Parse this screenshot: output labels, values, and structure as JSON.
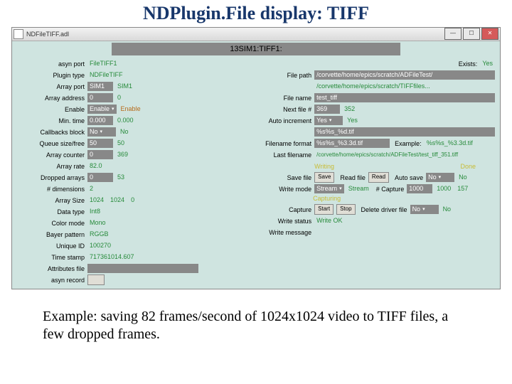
{
  "title": "NDPlugin.File display: TIFF",
  "window": {
    "title": "NDFileTIFF.adl"
  },
  "header": "13SIM1:TIFF1:",
  "left": {
    "asyn_port": {
      "label": "asyn port",
      "value": "FileTIFF1"
    },
    "plugin_type": {
      "label": "Plugin type",
      "value": "NDFileTIFF"
    },
    "array_port": {
      "label": "Array port",
      "field": "SIM1",
      "ro": "SIM1"
    },
    "array_addr": {
      "label": "Array address",
      "field": "0",
      "ro": "0"
    },
    "enable": {
      "label": "Enable",
      "field": "Enable",
      "ro": "Enable"
    },
    "min_time": {
      "label": "Min. time",
      "field": "0.000",
      "ro": "0.000"
    },
    "callbacks": {
      "label": "Callbacks block",
      "field": "No",
      "ro": "No"
    },
    "queue": {
      "label": "Queue size/free",
      "field": "50",
      "ro": "50"
    },
    "counter": {
      "label": "Array counter",
      "field": "0",
      "ro": "369"
    },
    "rate": {
      "label": "Array rate",
      "ro": "82.0"
    },
    "dropped": {
      "label": "Dropped arrays",
      "field": "0",
      "ro": "53"
    },
    "dims": {
      "label": "# dimensions",
      "ro": "2"
    },
    "size": {
      "label": "Array Size",
      "a": "1024",
      "b": "1024",
      "c": "0"
    },
    "dtype": {
      "label": "Data type",
      "ro": "Int8"
    },
    "cmode": {
      "label": "Color mode",
      "ro": "Mono"
    },
    "bayer": {
      "label": "Bayer pattern",
      "ro": "RGGB"
    },
    "uid": {
      "label": "Unique ID",
      "ro": "100270"
    },
    "ts": {
      "label": "Time stamp",
      "ro": "717361014.607"
    },
    "attr": {
      "label": "Attributes file",
      "field": ""
    },
    "arec": {
      "label": "asyn record",
      "btn": " "
    }
  },
  "right": {
    "filepath": {
      "label": "File path",
      "field": "/corvette/home/epics/scratch/ADFileTest/",
      "exists_lab": "Exists:",
      "exists": "Yes"
    },
    "filepath2": {
      "field": "/corvette/home/epics/scratch/TIFFfiles...",
      "label": ""
    },
    "fname": {
      "label": "File name",
      "field": "test_tiff"
    },
    "nextn": {
      "label": "Next file #",
      "field": "369",
      "ro": "352"
    },
    "autoinc": {
      "label": "Auto increment",
      "field": "Yes",
      "ro": "Yes"
    },
    "fmtempty": {
      "field": "%s%s_%d.tif"
    },
    "fmt": {
      "label": "Filename format",
      "field": "%s%s_%3.3d.tif",
      "ex_lab": "Example:",
      "ex": "%s%s_%3.3d.tif"
    },
    "lastf": {
      "label": "Last filename",
      "ro": "/corvette/home/epics/scratch/ADFileTest/test_tiff_351.tiff"
    },
    "sect1": "Writing",
    "done": "Done",
    "save": {
      "label": "Save file",
      "btn": "Save",
      "read_lab": "Read file",
      "read_btn": "Read",
      "auto_lab": "Auto save",
      "auto": "No",
      "auto_ro": "No"
    },
    "wmode": {
      "label": "Write mode",
      "field": "Stream",
      "ro": "Stream",
      "cap_lab": "# Capture",
      "cap_field": "1000",
      "cap_a": "1000",
      "cap_b": "157"
    },
    "sect2": "Capturing",
    "capture": {
      "label": "Capture",
      "start": "Start",
      "stop": "Stop",
      "del_lab": "Delete driver file",
      "del": "No",
      "del_ro": "No"
    },
    "wstatus": {
      "label": "Write status",
      "ro": "Write OK"
    },
    "wmsg": {
      "label": "Write message"
    }
  },
  "caption": "Example: saving 82 frames/second of 1024x1024 video to TIFF files, a few dropped frames."
}
